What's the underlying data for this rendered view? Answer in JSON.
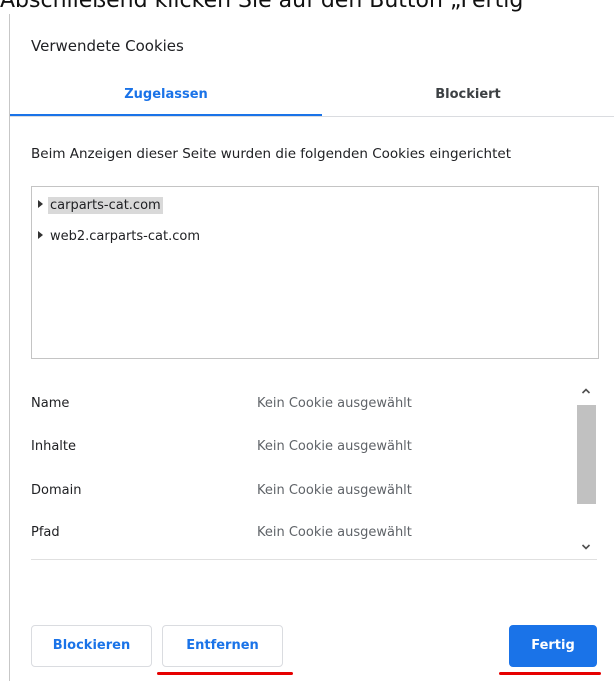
{
  "instruction_text": "Abschließend klicken Sie auf den Button „Fertig",
  "dialog": {
    "title": "Verwendete Cookies",
    "tabs": [
      {
        "label": "Zugelassen",
        "active": true
      },
      {
        "label": "Blockiert",
        "active": false
      }
    ],
    "description": "Beim Anzeigen dieser Seite wurden die folgenden Cookies eingerichtet",
    "tree": [
      {
        "label": "carparts-cat.com",
        "selected": true
      },
      {
        "label": "web2.carparts-cat.com",
        "selected": false
      }
    ],
    "details": [
      {
        "label": "Name",
        "value": "Kein Cookie ausgewählt"
      },
      {
        "label": "Inhalte",
        "value": "Kein Cookie ausgewählt"
      },
      {
        "label": "Domain",
        "value": "Kein Cookie ausgewählt"
      },
      {
        "label": "Pfad",
        "value": "Kein Cookie ausgewählt"
      }
    ],
    "buttons": {
      "block": "Blockieren",
      "remove": "Entfernen",
      "done": "Fertig"
    }
  },
  "colors": {
    "accent": "#1a73e8",
    "highlight_underline": "#e60000"
  },
  "icons": {
    "tree_expand": "triangle-right-icon",
    "scroll_up": "chevron-up-icon",
    "scroll_down": "chevron-down-icon"
  }
}
